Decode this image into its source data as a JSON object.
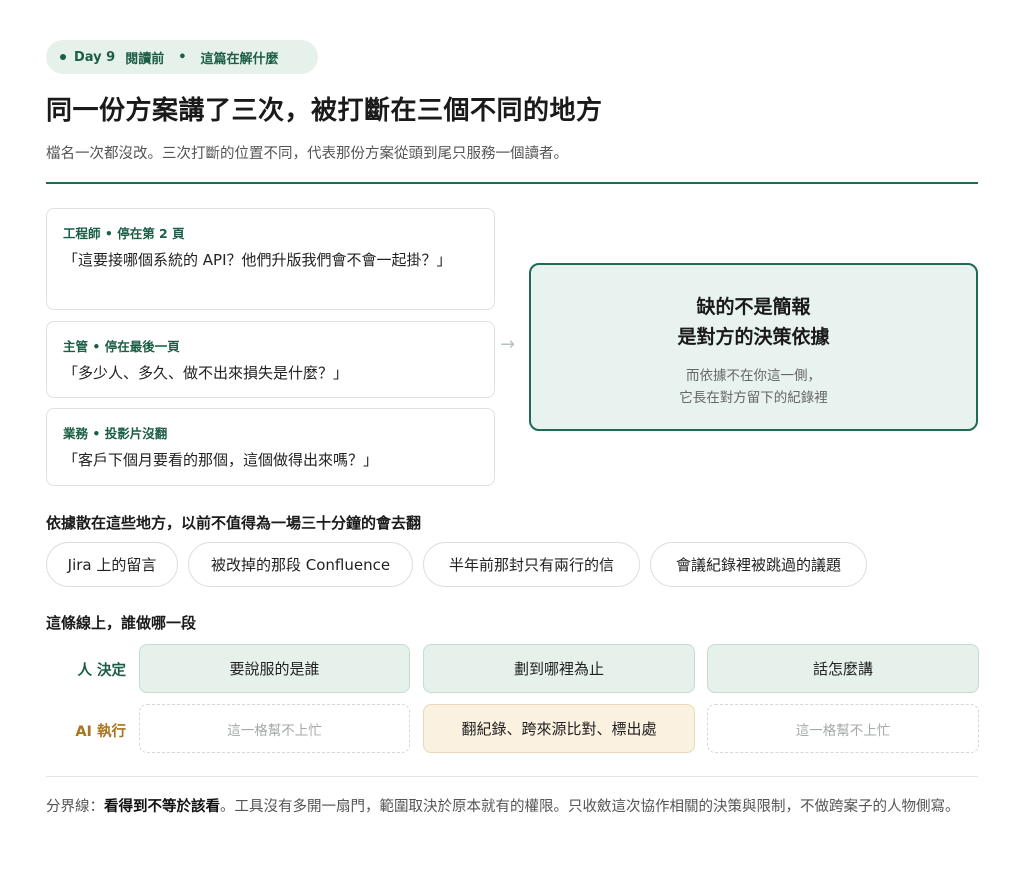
{
  "pill": {
    "day": "Day 9",
    "stage": "閱讀前",
    "dot_sep": "•",
    "topic": "這篇在解什麼"
  },
  "title": "同一份方案講了三次，被打斷在三個不同的地方",
  "subtitle": "檔名一次都沒改。三次打斷的位置不同，代表那份方案從頭到尾只服務一個讀者。",
  "quotes": [
    {
      "who": "工程師 • 停在第 2 頁",
      "text": "「這要接哪個系統的 API？他們升版我們會不會一起掛？」"
    },
    {
      "who": "主管 • 停在最後一頁",
      "text": "「多少人、多久、做不出來損失是什麼？」"
    },
    {
      "who": "業務 • 投影片沒翻",
      "text": "「客戶下個月要看的那個，這個做得出來嗎？」"
    }
  ],
  "arrow": "→",
  "callout": {
    "line1": "缺的不是簡報",
    "line2": "是對方的決策依據",
    "sub1": "而依據不在你這一側，",
    "sub2": "它長在對方留下的紀錄裡"
  },
  "sources": {
    "heading": "依據散在這些地方，以前不值得為一場三十分鐘的會去翻",
    "chips": [
      "Jira 上的留言",
      "被改掉的那段 Confluence",
      "半年前那封只有兩行的信",
      "會議紀錄裡被跳過的議題"
    ]
  },
  "division": {
    "heading": "這條線上，誰做哪一段",
    "human_label": "人 決定",
    "ai_label": "AI 執行",
    "human_cells": [
      "要說服的是誰",
      "劃到哪裡為止",
      "話怎麼講"
    ],
    "ai_cells": [
      "這一格幫不上忙",
      "翻紀錄、跨來源比對、標出處",
      "這一格幫不上忙"
    ]
  },
  "footer": {
    "prefix": "分界線：",
    "bold": "看得到不等於該看",
    "rest": "。工具沒有多開一扇門，範圍取決於原本就有的權限。只收斂這次協作相關的決策與限制，不做跨案子的人物側寫。"
  },
  "colors": {
    "accent": "#1b5e44",
    "human_cell": "#e6f1ec",
    "ai_cell": "#fbf1e1",
    "ai_label": "#a8741c"
  }
}
